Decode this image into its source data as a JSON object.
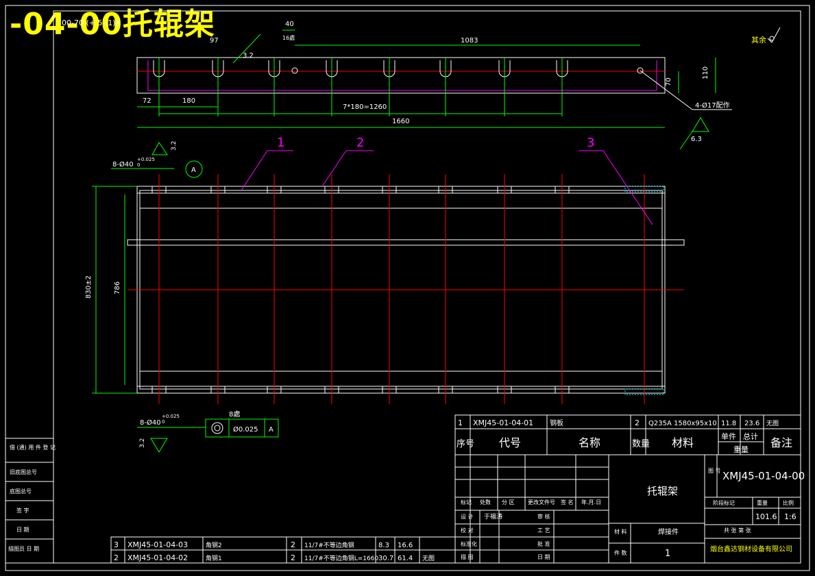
{
  "overlay_title": "-04-00托辊架",
  "drawing_number_ghost": "00-70 (+ 5 (1)X",
  "roughness_note": "其余",
  "top_view": {
    "dims": {
      "d40": "40",
      "d16": "16處",
      "d97": "97",
      "d32": "3.2",
      "d1083": "1083",
      "d110": "110",
      "d70": "70",
      "d72": "72",
      "d180": "180",
      "d7x180": "7*180=1260",
      "d1660": "1660",
      "holes_note": "4-Ø17配作",
      "roughness_63": "6.3"
    }
  },
  "main_view": {
    "balloons": [
      "1",
      "2",
      "3"
    ],
    "dims": {
      "holes_top": "8-Ø40",
      "tol_top": "+0.025",
      "tol_top2": "0",
      "roughness_top": "3.2",
      "datum": "A",
      "height_outer": "830±2",
      "height_inner": "786",
      "holes_bottom": "8-Ø40",
      "tol_bottom": "+0.025",
      "tol_bottom2": "0",
      "roughness_bottom": "3.2",
      "count_8": "8處",
      "tolerance_value": "Ø0.025",
      "tolerance_datum": "A"
    }
  },
  "left_strip": {
    "labels": [
      "借 (通) 用\n件 登 记",
      "旧底图总号",
      "底图总号",
      "签 字",
      "日 期",
      "描图员 日 期"
    ]
  },
  "bom_top": {
    "rows": [
      [
        "1",
        "XMJ45-01-04-01",
        "钢板",
        "2",
        "Q235A 1580x95x10",
        "11.8",
        "23.6",
        "无图"
      ]
    ],
    "header": [
      "序号",
      "代号",
      "名称",
      "数量",
      "材料",
      "单件",
      "总计",
      "备注"
    ],
    "weight_label": "重量"
  },
  "bom_bottom": {
    "rows": [
      [
        "3",
        "XMJ45-01-04-03",
        "角钢2",
        "2",
        "11/7#不等边角钢",
        "8.3",
        "16.6",
        ""
      ],
      [
        "2",
        "XMJ45-01-04-02",
        "角钢1",
        "2",
        "11/7#不等边角钢L=1660",
        "30.7",
        "61.4",
        "无图"
      ]
    ]
  },
  "title_block": {
    "part_name": "托辊架",
    "drawing_no": "XMJ45-01-04-00",
    "code_label": "图\n号",
    "change_labels": [
      "标记",
      "处数",
      "分 区",
      "更改文件号",
      "签 名",
      "年.月.日"
    ],
    "roles": [
      "设 计",
      "审 核",
      "校 对",
      "工 艺",
      "标准化",
      "批 准",
      "描 图",
      "日 期"
    ],
    "designer": "于福涛",
    "stage_header": [
      "阶段标记",
      "重量",
      "比例"
    ],
    "weight": "101.6",
    "scale": "1:6",
    "sheets": "共  张  第  张",
    "material_label": "材 料",
    "material_value": "焊接件",
    "qty_label": "件 数",
    "qty_value": "1",
    "company": "烟台鑫达钢材设备有限公司"
  },
  "colors": {
    "frame": "#ffffff",
    "dimension": "#00ff00",
    "center": "#ff0000",
    "leader": "#ff00ff",
    "hatch": "#00ffff",
    "overlay": "#ffff00"
  }
}
